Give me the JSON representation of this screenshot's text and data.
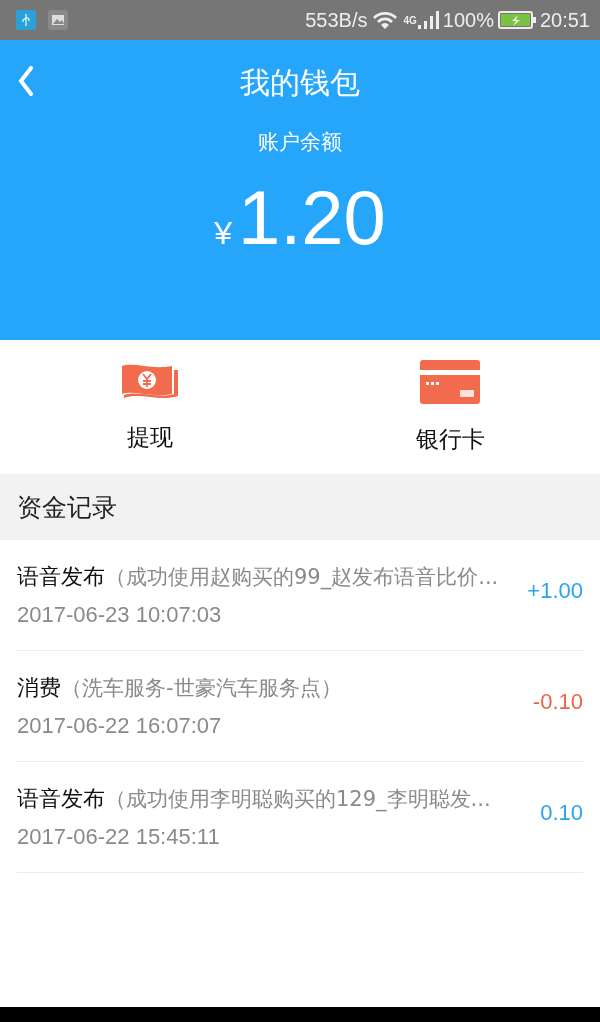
{
  "status_bar": {
    "speed": "553B/s",
    "network": "4G",
    "battery": "100%",
    "time": "20:51"
  },
  "header": {
    "title": "我的钱包",
    "balance_label": "账户余额",
    "currency": "¥",
    "balance": "1.20"
  },
  "actions": [
    {
      "label": "提现",
      "kind": "cash"
    },
    {
      "label": "银行卡",
      "kind": "card"
    }
  ],
  "section_title": "资金记录",
  "records": [
    {
      "title": "语音发布",
      "detail": "（成功使用赵购买的99_赵发布语音比价...",
      "time": "2017-06-23 10:07:03",
      "amount": "+1.00",
      "color": "#2aa4ec"
    },
    {
      "title": "消费",
      "detail": "（洗车服务-世豪汽车服务点）",
      "time": "2017-06-22 16:07:07",
      "amount": "-0.10",
      "color": "#f0624a"
    },
    {
      "title": "语音发布",
      "detail": "（成功使用李明聪购买的129_李明聪发...",
      "time": "2017-06-22 15:45:11",
      "amount": "0.10",
      "color": "#2aa4ec"
    }
  ]
}
